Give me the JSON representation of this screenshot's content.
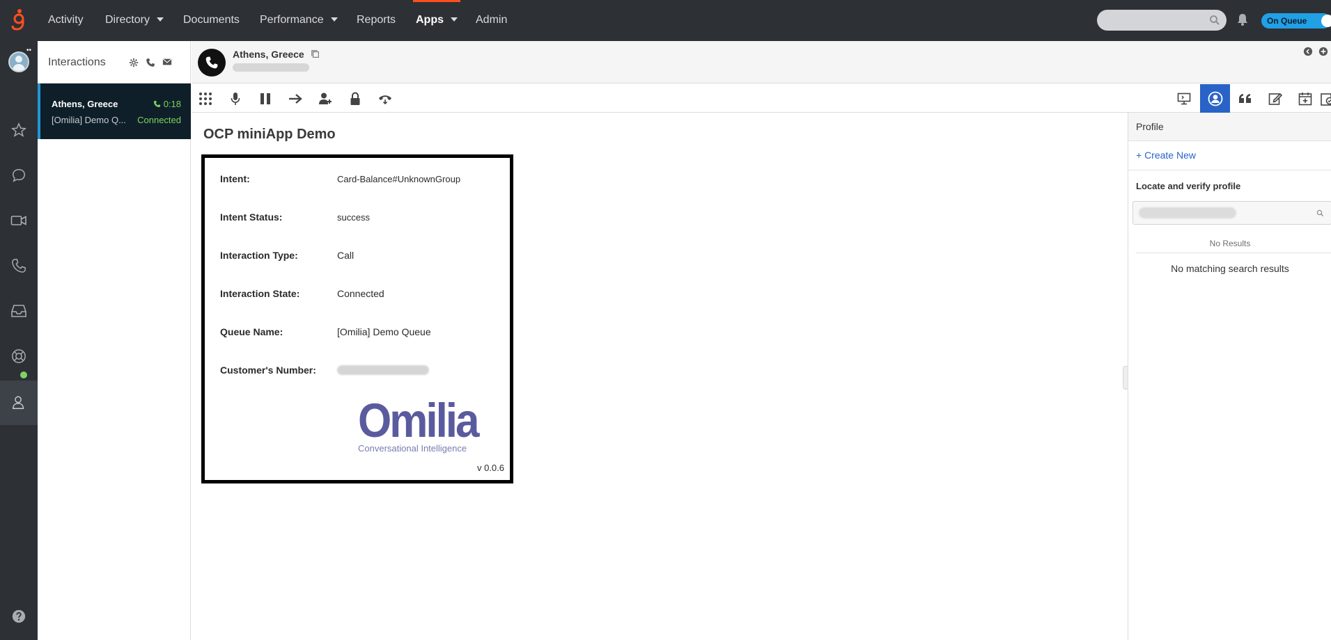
{
  "nav": {
    "items": [
      {
        "label": "Activity",
        "caret": false
      },
      {
        "label": "Directory",
        "caret": true
      },
      {
        "label": "Documents",
        "caret": false
      },
      {
        "label": "Performance",
        "caret": true
      },
      {
        "label": "Reports",
        "caret": false
      },
      {
        "label": "Apps",
        "caret": true,
        "active": true
      },
      {
        "label": "Admin",
        "caret": false
      }
    ],
    "queue_toggle": "On Queue",
    "accent_color": "#ff4f1f",
    "toggle_color": "#21a0e5"
  },
  "interactions": {
    "title": "Interactions",
    "card": {
      "name": "Athens, Greece",
      "timer": "0:18",
      "queue": "[Omilia] Demo Q...",
      "state": "Connected"
    }
  },
  "interaction_header": {
    "name": "Athens, Greece"
  },
  "app": {
    "title": "OCP miniApp Demo",
    "rows": [
      {
        "label": "Intent:",
        "value": "Card-Balance#UnknownGroup"
      },
      {
        "label": "Intent Status:",
        "value": "success"
      },
      {
        "label": "Interaction Type:",
        "value": "Call"
      },
      {
        "label": "Interaction State:",
        "value": "Connected"
      },
      {
        "label": "Queue Name:",
        "value": "[Omilia] Demo Queue"
      },
      {
        "label": "Customer's Number:",
        "value": ""
      }
    ],
    "logo_word": "Omilia",
    "logo_tagline": "Conversational Intelligence",
    "version": "v 0.0.6",
    "logo_color": "#5a5b9e"
  },
  "profile": {
    "title": "Profile",
    "create_new": "+ Create New",
    "locate_label": "Locate and verify profile",
    "no_results": "No Results",
    "no_matching": "No matching search results"
  }
}
